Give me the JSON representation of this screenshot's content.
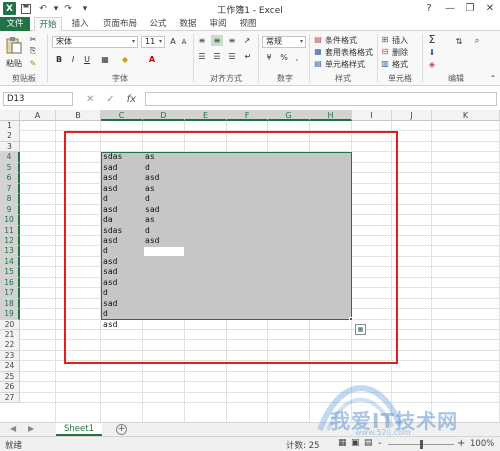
{
  "window": {
    "title": "工作簿1 - Excel",
    "help": "?",
    "minimize": "—",
    "restore": "❐",
    "close": "✕"
  },
  "qat": {
    "app_logo": "X",
    "save_icon": "save-icon",
    "undo_icon": "undo-icon",
    "redo_icon": "redo-icon",
    "customize_icon": "customize-icon"
  },
  "tabs": [
    "文件",
    "开始",
    "插入",
    "页面布局",
    "公式",
    "数据",
    "审阅",
    "视图"
  ],
  "ribbon": {
    "clipboard": {
      "paste": "粘贴",
      "label": "剪贴板"
    },
    "font": {
      "name": "宋体",
      "size": "11",
      "bold": "B",
      "italic": "I",
      "underline": "U",
      "label": "字体"
    },
    "alignment": {
      "label": "对齐方式"
    },
    "number": {
      "format": "常规",
      "percent": "%",
      "comma": ",",
      "label": "数字"
    },
    "styles": {
      "conditional": "条件格式",
      "table": "套用表格格式",
      "cell": "单元格样式",
      "label": "样式"
    },
    "cells": {
      "insert": "插入",
      "delete": "删除",
      "format": "格式",
      "label": "单元格"
    },
    "editing": {
      "sum": "Σ",
      "label": "编辑"
    }
  },
  "formula_bar": {
    "name_box": "D13",
    "fx": "fx",
    "value": ""
  },
  "columns": [
    "A",
    "B",
    "C",
    "D",
    "E",
    "F",
    "G",
    "H",
    "I",
    "J",
    "K"
  ],
  "rows": [
    "1",
    "2",
    "3",
    "4",
    "5",
    "6",
    "7",
    "8",
    "9",
    "10",
    "11",
    "12",
    "13",
    "14",
    "15",
    "16",
    "17",
    "18",
    "19",
    "20",
    "21",
    "22",
    "23",
    "24",
    "25",
    "26",
    "27"
  ],
  "cells": {
    "C": [
      "sdas",
      "sad",
      "asd",
      "asd",
      "d",
      "asd",
      "da",
      "sdas",
      "asd",
      "d",
      "asd",
      "sad",
      "asd",
      "d",
      "sad",
      "d",
      "asd"
    ],
    "D": [
      "as",
      "d",
      "asd",
      "as",
      "d",
      "sad",
      "as",
      "d",
      "asd",
      "",
      "",
      "",
      "",
      "",
      "",
      "",
      ""
    ]
  },
  "sheets": {
    "active": "Sheet1",
    "add": "+"
  },
  "status": {
    "mode": "就绪",
    "count": "计数: 25",
    "zoom": "100%",
    "minus": "-",
    "plus": "+"
  },
  "watermark": {
    "text": "我爱IT技术网",
    "url": "www.52ij.com"
  }
}
